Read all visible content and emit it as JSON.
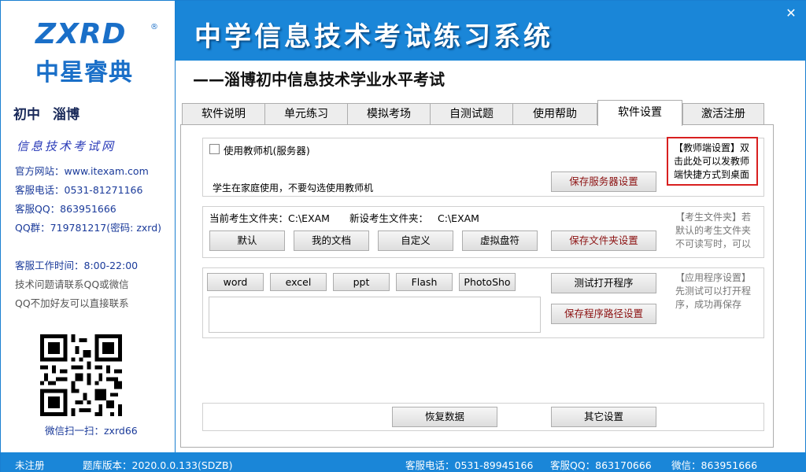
{
  "window": {
    "title": "中学信息技术考试练习系统",
    "subtitle": "——淄博初中信息技术学业水平考试",
    "close_symbol": "✕"
  },
  "logo": {
    "latin": "ZXRD",
    "registered": "®",
    "chinese": "中星睿典"
  },
  "sidebar": {
    "grade": "初中",
    "city": "淄博",
    "site_brand": "信息技术考试网",
    "website": "官方网站：www.itexam.com",
    "phone": "客服电话：0531-81271166",
    "qq": "客服QQ：863951666",
    "qq_group": "QQ群：719781217(密码: zxrd)",
    "work_time": "客服工作时间：8:00-22:00",
    "tip1": "技术问题请联系QQ或微信",
    "tip2": "QQ不加好友可以直接联系",
    "wechat": "微信扫一扫：zxrd66"
  },
  "tabs": [
    {
      "label": "软件说明"
    },
    {
      "label": "单元练习"
    },
    {
      "label": "模拟考场"
    },
    {
      "label": "自测试题"
    },
    {
      "label": "使用帮助"
    },
    {
      "label": "软件设置"
    },
    {
      "label": "激活注册"
    }
  ],
  "server_group": {
    "checkbox_label": "使用教师机(服务器)",
    "checked": false,
    "hint": "学生在家庭使用，不要勾选使用教师机",
    "save_button": "保存服务器设置",
    "note": "【教师端设置】双击此处可以发教师端快捷方式到桌面"
  },
  "folder_group": {
    "current_label": "当前考生文件夹：",
    "current_value": "C:\\EXAM",
    "new_label": "新设考生文件夹：",
    "new_value": "C:\\EXAM",
    "buttons": [
      "默认",
      "我的文档",
      "自定义",
      "虚拟盘符"
    ],
    "save_button": "保存文件夹设置",
    "note": "【考生文件夹】若默认的考生文件夹不可读写时，可以"
  },
  "app_group": {
    "buttons": [
      "word",
      "excel",
      "ppt",
      "Flash",
      "PhotoSho"
    ],
    "path_value": "",
    "test_button": "测试打开程序",
    "save_button": "保存程序路径设置",
    "note": "【应用程序设置】先测试可以打开程序，成功再保存"
  },
  "bottom_group": {
    "restore_button": "恢复数据",
    "other_button": "其它设置"
  },
  "statusbar": {
    "registration": "未注册",
    "db_version": "题库版本：2020.0.0.133(SDZB)",
    "phone": "客服电话：0531-89945166",
    "qq": "客服QQ：863170666",
    "wechat": "微信：863951666"
  },
  "colors": {
    "brand_blue": "#1a86d8",
    "callout_red": "#d82020",
    "button_text_red": "#8b1010"
  }
}
